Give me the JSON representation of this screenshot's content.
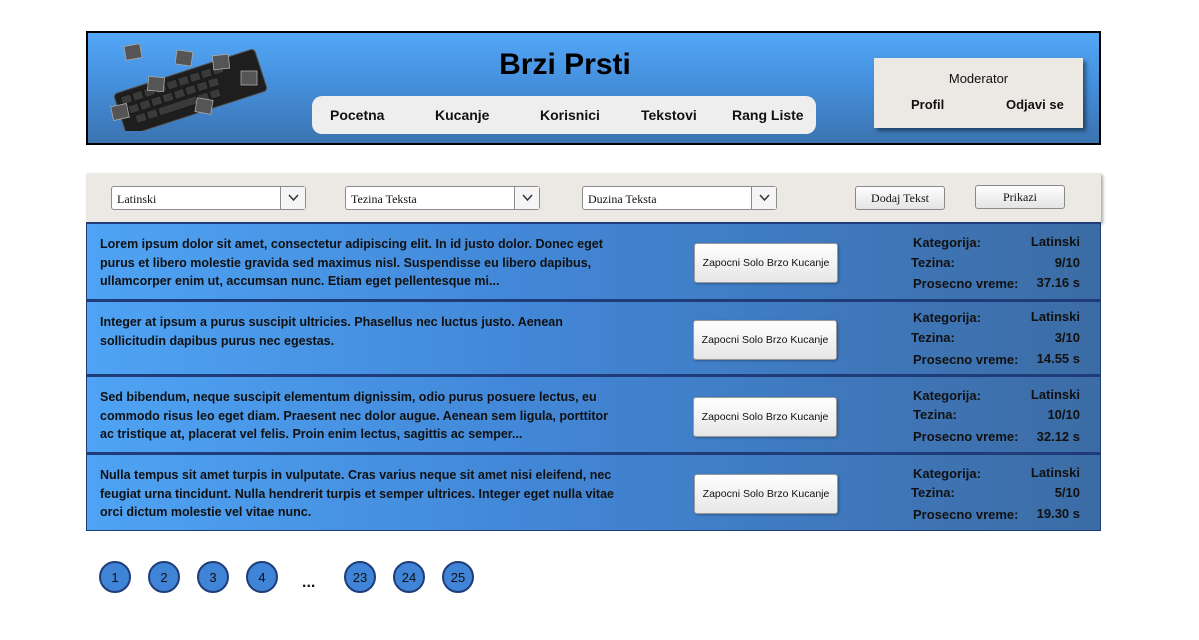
{
  "header": {
    "title": "Brzi Prsti",
    "nav": [
      "Pocetna",
      "Kucanje",
      "Korisnici",
      "Tekstovi",
      "Rang Liste"
    ],
    "user": {
      "role": "Moderator",
      "profile": "Profil",
      "logout": "Odjavi se"
    }
  },
  "filters": {
    "alphabet": "Latinski",
    "difficulty": "Tezina Teksta",
    "length": "Duzina Teksta",
    "add_label": "Dodaj Tekst",
    "show_label": "Prikazi"
  },
  "labels": {
    "category": "Kategorija:",
    "difficulty": "Tezina:",
    "avg_time": "Prosecno vreme:",
    "start_button": "Zapocni Solo Brzo Kucanje"
  },
  "texts": [
    {
      "body": "Lorem ipsum dolor sit amet, consectetur adipiscing elit. In id justo dolor. Donec eget purus et libero molestie gravida sed maximus nisl. Suspendisse eu libero dapibus, ullamcorper enim ut, accumsan nunc. Etiam eget pellentesque mi...",
      "category": "Latinski",
      "difficulty": "9/10",
      "avg_time": "37.16 s"
    },
    {
      "body": "Integer at ipsum a purus suscipit ultricies. Phasellus nec luctus justo. Aenean sollicitudin dapibus purus nec egestas.",
      "category": "Latinski",
      "difficulty": "3/10",
      "avg_time": "14.55 s"
    },
    {
      "body": "Sed bibendum, neque suscipit elementum dignissim, odio purus posuere lectus, eu commodo risus leo eget diam. Praesent nec dolor augue. Aenean sem ligula, porttitor ac tristique at, placerat vel felis. Proin enim lectus, sagittis ac semper...",
      "category": "Latinski",
      "difficulty": "10/10",
      "avg_time": "32.12 s"
    },
    {
      "body": "Nulla tempus sit amet turpis in vulputate. Cras varius neque sit amet nisi eleifend, nec feugiat urna tincidunt. Nulla hendrerit turpis et semper ultrices. Integer eget nulla vitae orci dictum molestie vel vitae nunc.",
      "category": "Latinski",
      "difficulty": "5/10",
      "avg_time": "19.30 s"
    }
  ],
  "pagination": {
    "pages": [
      "1",
      "2",
      "3",
      "4",
      "23",
      "24",
      "25"
    ],
    "ellipsis": "..."
  },
  "colors": {
    "header_gradient": [
      "#53a7f7",
      "#3b73b0"
    ],
    "row_gradient": [
      "#4fa3f4",
      "#3c6ca5"
    ],
    "page_button": "#3f84d6",
    "border_dark": "#1f3c78"
  }
}
